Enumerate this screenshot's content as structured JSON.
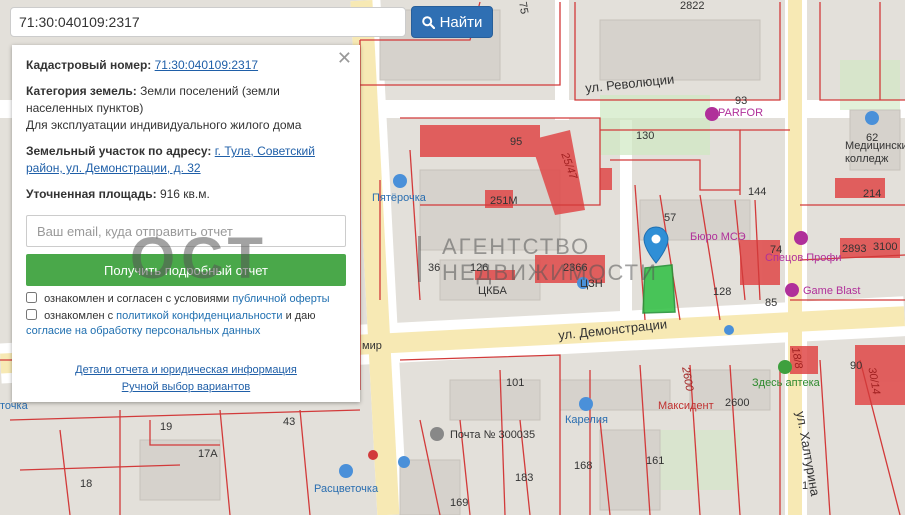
{
  "search": {
    "value": "71:30:040109:2317",
    "button_label": "Найти"
  },
  "panel": {
    "cadastral_label": "Кадастровый номер:",
    "cadastral_value": "71:30:040109:2317",
    "category_label": "Категория земель:",
    "category_value": "Земли поселений (земли населенных пунктов)",
    "usage_value": "Для эксплуатации индивидуального жилого дома",
    "address_label": "Земельный участок по адресу:",
    "address_value": "г. Тула, Советский район, ул. Демонстрации, д. 32",
    "area_label": "Уточненная площадь:",
    "area_value": "916 кв.м.",
    "email_placeholder": "Ваш email, куда отправить отчет",
    "report_button": "Получить подробный отчет",
    "consent1_prefix": "ознакомлен и согласен с условиями",
    "consent1_link": "публичной оферты",
    "consent2_prefix": "ознакомлен с",
    "consent2_link": "политикой конфиденциальности",
    "consent2_mid": "и даю",
    "consent2_link2": "согласие на обработку персональных данных",
    "details_link": "Детали отчета и юридическая информация",
    "manual_link": "Ручной выбор вариантов"
  },
  "watermark": {
    "logo": "ОСТ",
    "line1": "АГЕНТСТВО",
    "line2": "НЕДВИЖИМОСТИ"
  },
  "map": {
    "streets": [
      "ул. Революции",
      "ул. Демонстрации",
      "ул. Халтурина"
    ],
    "pois": [
      "PARFOR",
      "Пятёрочка",
      "ЦКБА",
      "ЦЗН",
      "Бюро МСЭ",
      "Спецов Профи",
      "Game Blast",
      "Медицинский колледж",
      "Здесь аптека",
      "Максидент",
      "Карелия",
      "Почта № 300035",
      "Расцветочка",
      "мир",
      "точка"
    ],
    "numbers": [
      "75",
      "2822",
      "93",
      "62",
      "95",
      "25/47",
      "130",
      "144",
      "214",
      "251М",
      "57",
      "2893",
      "3100",
      "36",
      "126",
      "2366",
      "128",
      "74",
      "85",
      "101",
      "2600",
      "2600",
      "18/8",
      "90",
      "30/14",
      "19",
      "43",
      "17А",
      "18",
      "168",
      "161",
      "169",
      "183",
      "1",
      "67",
      "3",
      "75",
      "5"
    ],
    "accent_colors": {
      "parcel": "#38c24a",
      "marker": "#2f8fd6",
      "boundary": "#d23a3a",
      "building": "#e04848"
    }
  }
}
